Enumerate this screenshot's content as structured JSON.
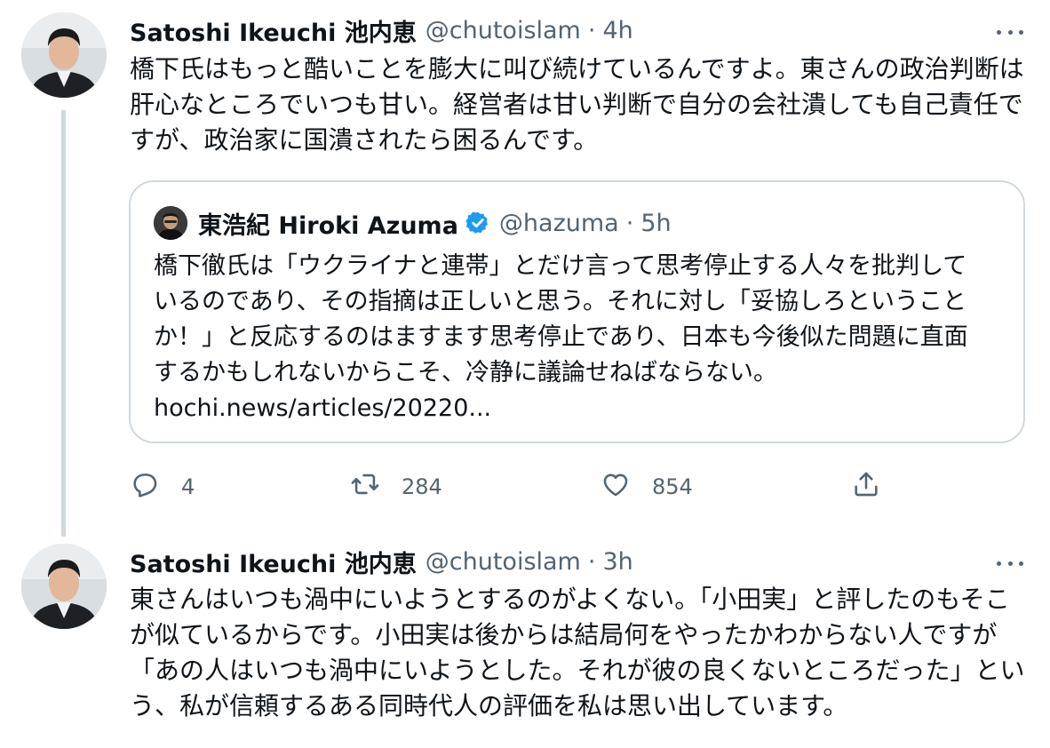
{
  "tweet1": {
    "name": "Satoshi Ikeuchi 池内恵",
    "handle": "@chutoislam",
    "separator": "·",
    "time": "4h",
    "text_lines": [
      "橋下氏はもっと酷いことを膨大に叫び続けているんですよ。東さんの政治判断は",
      "肝心なところでいつも甘い。経営者は甘い判断で自分の会社潰しても自己責任で",
      "すが、政治家に国潰されたら困るんです。"
    ],
    "quote": {
      "name": "東浩紀 Hiroki Azuma",
      "handle": "@hazuma",
      "separator": "·",
      "time": "5h",
      "text_lines": [
        "橋下徹氏は「ウクライナと連帯」とだけ言って思考停止する人々を批判して",
        "いるのであり、その指摘は正しいと思う。それに対し「妥協しろということ",
        "か！」と反応するのはますます思考停止であり、日本も今後似た問題に直面",
        "するかもしれないからこそ、冷静に議論せねばならない。",
        "hochi.news/articles/20220..."
      ]
    },
    "actions": {
      "reply_icon": "reply-icon",
      "reply_count": "4",
      "retweet_icon": "retweet-icon",
      "retweet_count": "284",
      "like_icon": "heart-icon",
      "like_count": "854",
      "share_icon": "share-icon"
    }
  },
  "tweet2": {
    "name": "Satoshi Ikeuchi 池内恵",
    "handle": "@chutoislam",
    "separator": "·",
    "time": "3h",
    "text_lines": [
      "東さんはいつも渦中にいようとするのがよくない。「小田実」と評したのもそこ",
      "が似ているからです。小田実は後からは結局何をやったかわからない人ですが",
      "「あの人はいつも渦中にいようとした。それが彼の良くないところだった」とい",
      "う、私が信頼するある同時代人の評価を私は思い出しています。"
    ]
  },
  "colors": {
    "text": "#0f1419",
    "secondary": "#536471",
    "border": "#cfd9de",
    "verified": "#1d9bf0"
  }
}
